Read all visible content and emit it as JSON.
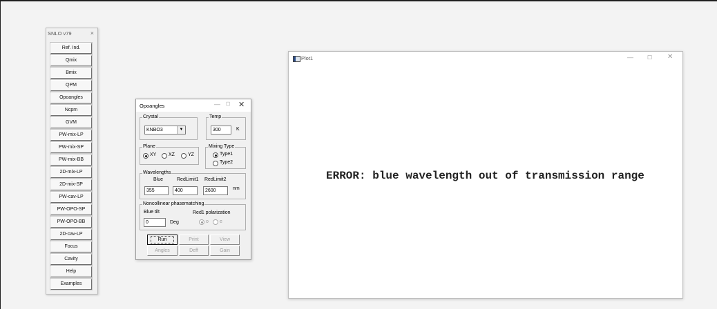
{
  "snlo": {
    "title": "SNLO v79",
    "close": "×",
    "buttons": [
      "Ref. Ind.",
      "Qmix",
      "Bmix",
      "QPM",
      "Opoangles",
      "Ncpm",
      "GVM",
      "PW-mix-LP",
      "PW-mix-SP",
      "PW-mix-BB",
      "2D-mix-LP",
      "2D-mix-SP",
      "PW-cav-LP",
      "PW-OPO-SP",
      "PW-OPO-BB",
      "2D-cav-LP",
      "Focus",
      "Cavity",
      "Help",
      "Examples"
    ]
  },
  "opoangles": {
    "title": "Opoangles",
    "controls": {
      "minimize": "—",
      "maximize": "☐",
      "close": "✕"
    },
    "crystal": {
      "label": "Crystal",
      "value": "KNBO3",
      "arrow": "▼"
    },
    "temp": {
      "label": "Temp",
      "value": "300",
      "unit": "K"
    },
    "plane": {
      "label": "Plane",
      "options": [
        "XY",
        "XZ",
        "YZ"
      ],
      "selected": "XY"
    },
    "mixing": {
      "label": "Mixing Type",
      "options": [
        "Type1",
        "Type2"
      ],
      "selected": "Type1"
    },
    "wavelengths": {
      "label": "Wavelengths",
      "blue_label": "Blue",
      "red1_label": "RedLimit1",
      "red2_label": "RedLimit2",
      "blue": "355",
      "red1": "400",
      "red2": "2600",
      "unit": "nm"
    },
    "noncollinear": {
      "label": "Noncollinear phasematching",
      "blue_tilt_label": "Blue tilt",
      "blue_tilt": "0",
      "deg": "Deg",
      "polarization_label": "Red1 polarization",
      "pol_o": "o",
      "pol_e": "e",
      "selected": "o"
    },
    "buttons": {
      "run": "Run",
      "print": "Print",
      "view": "View",
      "angles": "Angles",
      "deff": "Deff",
      "gain": "Gain"
    }
  },
  "plot": {
    "title": "Plot1",
    "controls": {
      "minimize": "—",
      "maximize": "☐",
      "close": "✕"
    },
    "message": "ERROR: blue wavelength out of transmission range"
  }
}
